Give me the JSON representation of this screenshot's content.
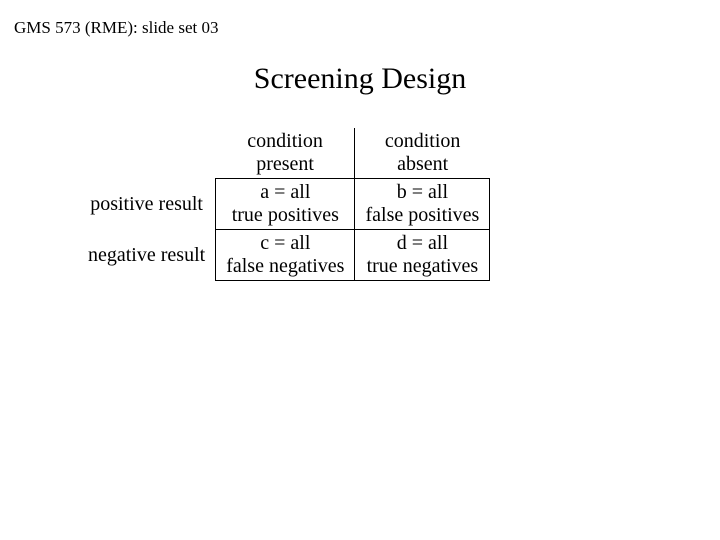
{
  "header": {
    "label": "GMS 573 (RME): slide set 03"
  },
  "title": "Screening Design",
  "table": {
    "col_headers": {
      "left": {
        "line1": "condition",
        "line2": "present"
      },
      "right": {
        "line1": "condition",
        "line2": "absent"
      }
    },
    "rows": {
      "r1": {
        "label": "positive result",
        "c1": {
          "line1": "a = all",
          "line2": "true positives"
        },
        "c2": {
          "line1": "b = all",
          "line2": "false positives"
        }
      },
      "r2": {
        "label": "negative result",
        "c1": {
          "line1": "c = all",
          "line2": "false negatives"
        },
        "c2": {
          "line1": "d = all",
          "line2": "true negatives"
        }
      }
    }
  }
}
